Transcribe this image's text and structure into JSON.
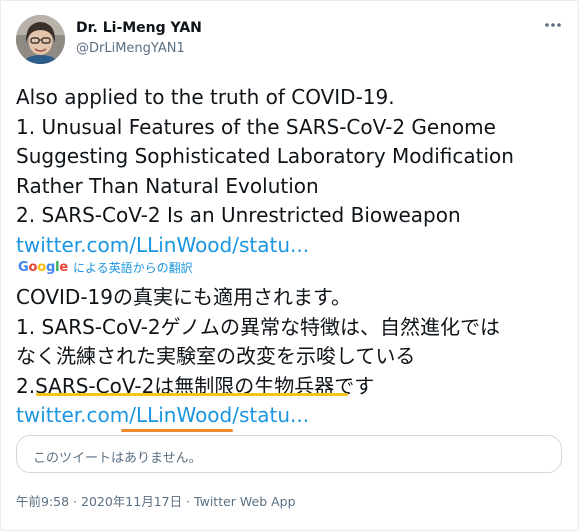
{
  "author": {
    "name": "Dr. Li-Meng YAN",
    "handle": "@DrLiMengYAN1"
  },
  "tweet": {
    "lines": [
      "Also applied to the truth of COVID-19.",
      "1. Unusual Features of the SARS-CoV-2 Genome",
      "Suggesting Sophisticated Laboratory Modification",
      "Rather Than Natural Evolution",
      "2. SARS-CoV-2 Is an Unrestricted Bioweapon"
    ],
    "link": "twitter.com/LLinWood/statu..."
  },
  "translation": {
    "google": "Google",
    "label": "による英語からの翻訳",
    "lines": [
      "COVID-19の真実にも適用されます。",
      " 1. SARS-CoV-2ゲノムの異常な特徴は、自然進化では",
      "なく洗練された実験室の改変を示唆している",
      "2.SARS-CoV-2は無制限の生物兵器です"
    ],
    "link": "twitter.com/LLinWood/statu..."
  },
  "quote": {
    "text": "このツイートはありません。"
  },
  "meta": {
    "timestamp": "午前9:58 · 2020年11月17日 · Twitter Web App"
  },
  "icons": {
    "more": "more-horizontal-icon",
    "avatar": "profile-photo"
  },
  "colors": {
    "link": "#1b95e0",
    "secondary_text": "#5b7083",
    "highlight_yellow": "#f5c518",
    "highlight_orange": "#f08a2c"
  }
}
